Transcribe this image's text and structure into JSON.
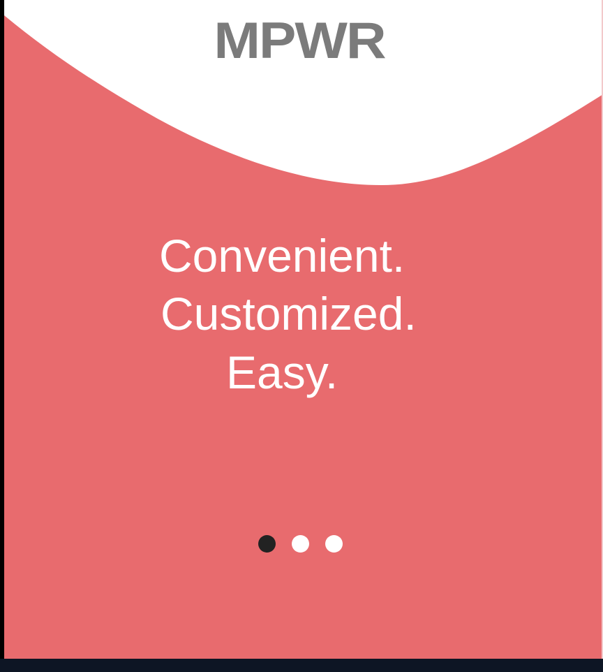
{
  "app": {
    "logo_text": "MPWR"
  },
  "onboarding": {
    "tagline_lines": [
      "Convenient.",
      "Customized.",
      "Easy."
    ],
    "pager": {
      "total_pages": 3,
      "current_page": 1
    }
  },
  "colors": {
    "background_accent": "#e86b6e",
    "wave": "#ffffff",
    "logo": "#7b7b7b",
    "tagline": "#ffffff",
    "dot_active": "#222222",
    "dot_inactive": "#ffffff",
    "bottom_bar": "#0d1524"
  }
}
